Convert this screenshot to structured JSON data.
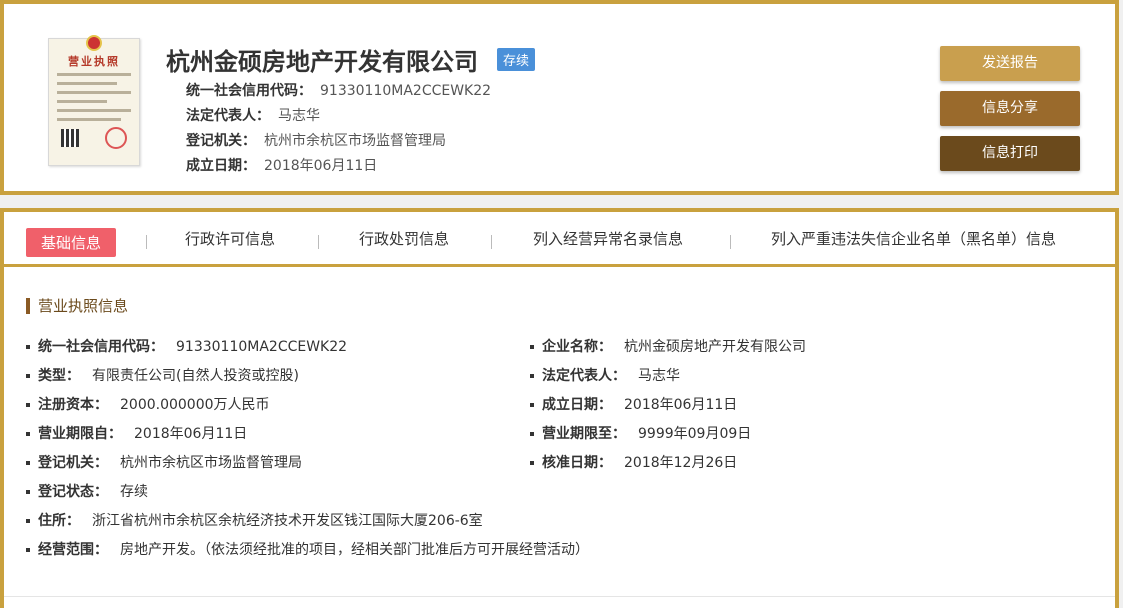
{
  "header": {
    "license_thumb_title": "营业执照",
    "company_name": "杭州金硕房地产开发有限公司",
    "status_tag": "存续",
    "info": [
      {
        "label": "统一社会信用代码：",
        "value": "91330110MA2CCEWK22"
      },
      {
        "label": "法定代表人：",
        "value": "马志华"
      },
      {
        "label": "登记机关：",
        "value": "杭州市余杭区市场监督管理局"
      },
      {
        "label": "成立日期：",
        "value": "2018年06月11日"
      }
    ],
    "buttons": {
      "send_report": "发送报告",
      "share_info": "信息分享",
      "print_info": "信息打印"
    }
  },
  "tabs": [
    "基础信息",
    "行政许可信息",
    "行政处罚信息",
    "列入经营异常名录信息",
    "列入严重违法失信企业名单（黑名单）信息"
  ],
  "section_title": "营业执照信息",
  "fields": {
    "credit_code": {
      "label": "统一社会信用代码：",
      "value": "91330110MA2CCEWK22"
    },
    "company_name": {
      "label": "企业名称：",
      "value": "杭州金硕房地产开发有限公司"
    },
    "type": {
      "label": "类型：",
      "value": "有限责任公司(自然人投资或控股)"
    },
    "legal_rep": {
      "label": "法定代表人：",
      "value": "马志华"
    },
    "reg_capital": {
      "label": "注册资本：",
      "value": "2000.000000万人民币"
    },
    "established": {
      "label": "成立日期：",
      "value": "2018年06月11日"
    },
    "term_from": {
      "label": "营业期限自：",
      "value": "2018年06月11日"
    },
    "term_to": {
      "label": "营业期限至：",
      "value": "9999年09月09日"
    },
    "reg_authority": {
      "label": "登记机关：",
      "value": "杭州市余杭区市场监督管理局"
    },
    "approval_date": {
      "label": "核准日期：",
      "value": "2018年12月26日"
    },
    "reg_status": {
      "label": "登记状态：",
      "value": "存续"
    },
    "address": {
      "label": "住所：",
      "value": "浙江省杭州市余杭区余杭经济技术开发区钱江国际大厦206-6室"
    },
    "scope": {
      "label": "经营范围：",
      "value": "房地产开发。（依法须经批准的项目，经相关部门批准后方可开展经营活动）"
    }
  }
}
